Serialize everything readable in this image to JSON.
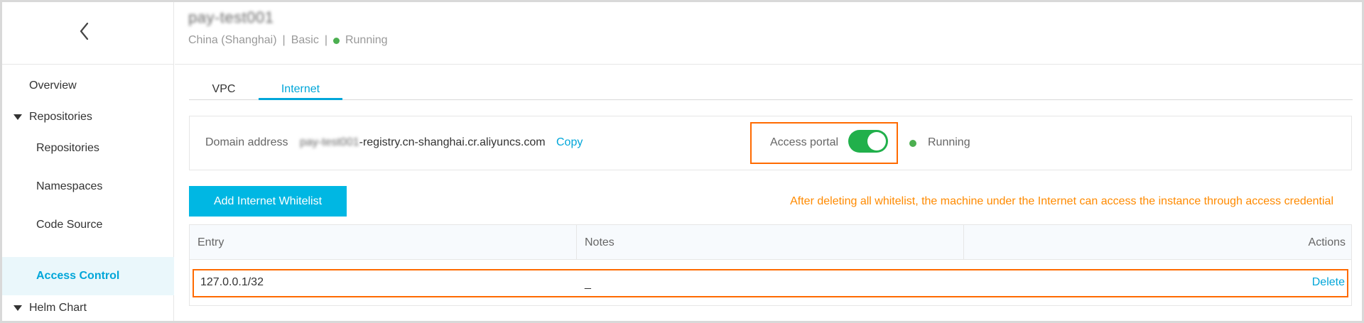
{
  "header": {
    "instance_name": "pay-test001",
    "region": "China (Shanghai)",
    "separator": "|",
    "edition": "Basic",
    "status": "Running"
  },
  "sidebar": {
    "items": [
      {
        "label": "Overview"
      },
      {
        "label": "Repositories"
      },
      {
        "label": "Repositories"
      },
      {
        "label": "Namespaces"
      },
      {
        "label": "Code Source"
      },
      {
        "label": "Access Control"
      },
      {
        "label": "Helm Chart"
      }
    ]
  },
  "tabs": [
    {
      "label": "VPC"
    },
    {
      "label": "Internet"
    }
  ],
  "domain": {
    "label": "Domain address",
    "prefix": "pay-test001",
    "suffix": "-registry.cn-shanghai.cr.aliyuncs.com",
    "copy_label": "Copy",
    "access_label": "Access portal",
    "access_enabled": true,
    "status": "Running"
  },
  "whitelist": {
    "add_button": "Add Internet Whitelist",
    "warning": "After deleting all whitelist, the machine under the Internet can access the instance through access credential"
  },
  "table": {
    "columns": [
      "Entry",
      "Notes",
      "Actions"
    ],
    "rows": [
      {
        "entry": "127.0.0.1/32",
        "notes": "_",
        "action": "Delete"
      }
    ]
  },
  "colors": {
    "accent": "#00a6d9",
    "button": "#00b7e3",
    "toggle_on": "#21b04b",
    "highlight": "#ff6a00",
    "warning": "#ff8a00",
    "status_ok": "#4caf50"
  }
}
